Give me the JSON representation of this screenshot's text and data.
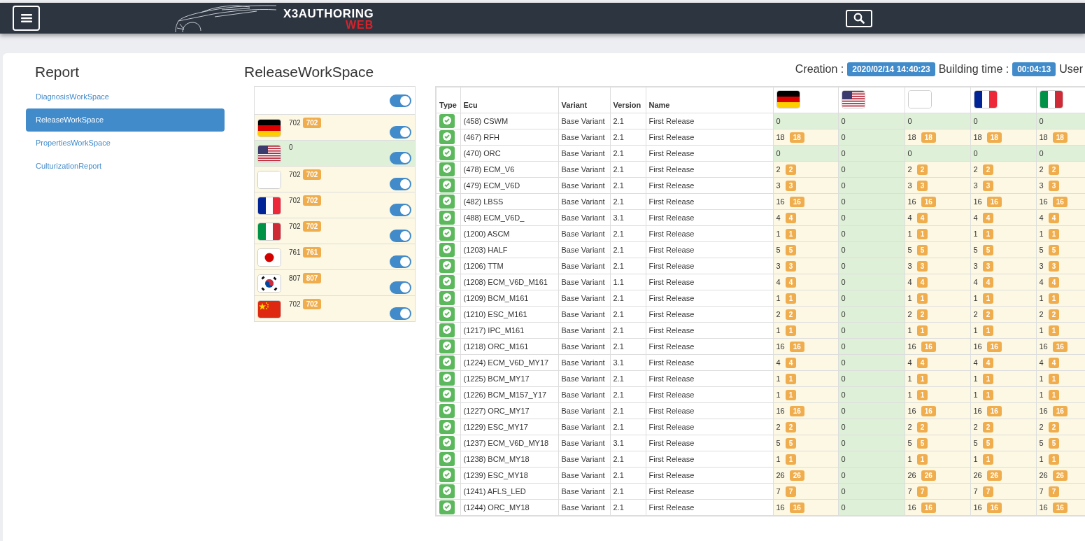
{
  "logo": {
    "title": "X3AUTHORING",
    "subtitle": "WEB"
  },
  "sidebar": {
    "title": "Report",
    "items": [
      {
        "label": "DiagnosisWorkSpace",
        "selected": false
      },
      {
        "label": "ReleaseWorkSpace",
        "selected": true
      },
      {
        "label": "PropertiesWorkSpace",
        "selected": false
      },
      {
        "label": "CulturizationReport",
        "selected": false
      }
    ]
  },
  "page_title": "ReleaseWorkSpace",
  "info": {
    "creation_label": "Creation :",
    "creation": "2020/02/14 14:40:23",
    "building_label": "Building time :",
    "building": "00:04:13",
    "user_label": "User"
  },
  "languages": {
    "all_on": true,
    "items": [
      {
        "kind": "de",
        "count": "702",
        "badge": "702",
        "on": true
      },
      {
        "kind": "us",
        "count": "0",
        "on": true
      },
      {
        "kind": "blank",
        "count": "702",
        "badge": "702",
        "on": true
      },
      {
        "kind": "fr",
        "count": "702",
        "badge": "702",
        "on": true
      },
      {
        "kind": "it",
        "count": "702",
        "badge": "702",
        "on": true
      },
      {
        "kind": "jp",
        "count": "761",
        "badge": "761",
        "on": true
      },
      {
        "kind": "kr",
        "count": "807",
        "badge": "807",
        "on": true
      },
      {
        "kind": "cn",
        "count": "702",
        "badge": "702",
        "on": true
      }
    ]
  },
  "table": {
    "columns": [
      "Type",
      "Ecu",
      "Variant",
      "Version",
      "Name"
    ],
    "flag_columns": [
      {
        "kind": "de"
      },
      {
        "kind": "us"
      },
      {
        "kind": "blank"
      },
      {
        "kind": "fr"
      },
      {
        "kind": "it"
      }
    ],
    "rows": [
      {
        "ecu": "(458) CSWM",
        "variant": "Base Variant",
        "version": "2.1",
        "name": "First Release",
        "cells": [
          {
            "value": "0"
          },
          {
            "value": "0"
          },
          {
            "value": "0"
          },
          {
            "value": "0"
          },
          {
            "value": "0"
          }
        ]
      },
      {
        "ecu": "(467) RFH",
        "variant": "Base Variant",
        "version": "2.1",
        "name": "First Release",
        "cells": [
          {
            "value": "18",
            "badge": "18"
          },
          {
            "value": "0"
          },
          {
            "value": "18",
            "badge": "18"
          },
          {
            "value": "18",
            "badge": "18"
          },
          {
            "value": "18",
            "badge": "18"
          }
        ]
      },
      {
        "ecu": "(470) ORC",
        "variant": "Base Variant",
        "version": "2.1",
        "name": "First Release",
        "cells": [
          {
            "value": "0"
          },
          {
            "value": "0"
          },
          {
            "value": "0"
          },
          {
            "value": "0"
          },
          {
            "value": "0"
          }
        ]
      },
      {
        "ecu": "(478) ECM_V6",
        "variant": "Base Variant",
        "version": "2.1",
        "name": "First Release",
        "cells": [
          {
            "value": "2",
            "badge": "2"
          },
          {
            "value": "0"
          },
          {
            "value": "2",
            "badge": "2"
          },
          {
            "value": "2",
            "badge": "2"
          },
          {
            "value": "2",
            "badge": "2"
          }
        ]
      },
      {
        "ecu": "(479) ECM_V6D",
        "variant": "Base Variant",
        "version": "2.1",
        "name": "First Release",
        "cells": [
          {
            "value": "3",
            "badge": "3"
          },
          {
            "value": "0"
          },
          {
            "value": "3",
            "badge": "3"
          },
          {
            "value": "3",
            "badge": "3"
          },
          {
            "value": "3",
            "badge": "3"
          }
        ]
      },
      {
        "ecu": "(482) LBSS",
        "variant": "Base Variant",
        "version": "2.1",
        "name": "First Release",
        "cells": [
          {
            "value": "16",
            "badge": "16"
          },
          {
            "value": "0"
          },
          {
            "value": "16",
            "badge": "16"
          },
          {
            "value": "16",
            "badge": "16"
          },
          {
            "value": "16",
            "badge": "16"
          }
        ]
      },
      {
        "ecu": "(488) ECM_V6D_",
        "variant": "Base Variant",
        "version": "3.1",
        "name": "First Release",
        "cells": [
          {
            "value": "4",
            "badge": "4"
          },
          {
            "value": "0"
          },
          {
            "value": "4",
            "badge": "4"
          },
          {
            "value": "4",
            "badge": "4"
          },
          {
            "value": "4",
            "badge": "4"
          }
        ]
      },
      {
        "ecu": "(1200) ASCM",
        "variant": "Base Variant",
        "version": "2.1",
        "name": "First Release",
        "cells": [
          {
            "value": "1",
            "badge": "1"
          },
          {
            "value": "0"
          },
          {
            "value": "1",
            "badge": "1"
          },
          {
            "value": "1",
            "badge": "1"
          },
          {
            "value": "1",
            "badge": "1"
          }
        ]
      },
      {
        "ecu": "(1203) HALF",
        "variant": "Base Variant",
        "version": "2.1",
        "name": "First Release",
        "cells": [
          {
            "value": "5",
            "badge": "5"
          },
          {
            "value": "0"
          },
          {
            "value": "5",
            "badge": "5"
          },
          {
            "value": "5",
            "badge": "5"
          },
          {
            "value": "5",
            "badge": "5"
          }
        ]
      },
      {
        "ecu": "(1206) TTM",
        "variant": "Base Variant",
        "version": "2.1",
        "name": "First Release",
        "cells": [
          {
            "value": "3",
            "badge": "3"
          },
          {
            "value": "0"
          },
          {
            "value": "3",
            "badge": "3"
          },
          {
            "value": "3",
            "badge": "3"
          },
          {
            "value": "3",
            "badge": "3"
          }
        ]
      },
      {
        "ecu": "(1208) ECM_V6D_M161",
        "variant": "Base Variant",
        "version": "1.1",
        "name": "First Release",
        "cells": [
          {
            "value": "4",
            "badge": "4"
          },
          {
            "value": "0"
          },
          {
            "value": "4",
            "badge": "4"
          },
          {
            "value": "4",
            "badge": "4"
          },
          {
            "value": "4",
            "badge": "4"
          }
        ]
      },
      {
        "ecu": "(1209) BCM_M161",
        "variant": "Base Variant",
        "version": "2.1",
        "name": "First Release",
        "cells": [
          {
            "value": "1",
            "badge": "1"
          },
          {
            "value": "0"
          },
          {
            "value": "1",
            "badge": "1"
          },
          {
            "value": "1",
            "badge": "1"
          },
          {
            "value": "1",
            "badge": "1"
          }
        ]
      },
      {
        "ecu": "(1210) ESC_M161",
        "variant": "Base Variant",
        "version": "2.1",
        "name": "First Release",
        "cells": [
          {
            "value": "2",
            "badge": "2"
          },
          {
            "value": "0"
          },
          {
            "value": "2",
            "badge": "2"
          },
          {
            "value": "2",
            "badge": "2"
          },
          {
            "value": "2",
            "badge": "2"
          }
        ]
      },
      {
        "ecu": "(1217) IPC_M161",
        "variant": "Base Variant",
        "version": "2.1",
        "name": "First Release",
        "cells": [
          {
            "value": "1",
            "badge": "1"
          },
          {
            "value": "0"
          },
          {
            "value": "1",
            "badge": "1"
          },
          {
            "value": "1",
            "badge": "1"
          },
          {
            "value": "1",
            "badge": "1"
          }
        ]
      },
      {
        "ecu": "(1218) ORC_M161",
        "variant": "Base Variant",
        "version": "2.1",
        "name": "First Release",
        "cells": [
          {
            "value": "16",
            "badge": "16"
          },
          {
            "value": "0"
          },
          {
            "value": "16",
            "badge": "16"
          },
          {
            "value": "16",
            "badge": "16"
          },
          {
            "value": "16",
            "badge": "16"
          }
        ]
      },
      {
        "ecu": "(1224) ECM_V6D_MY17",
        "variant": "Base Variant",
        "version": "3.1",
        "name": "First Release",
        "cells": [
          {
            "value": "4",
            "badge": "4"
          },
          {
            "value": "0"
          },
          {
            "value": "4",
            "badge": "4"
          },
          {
            "value": "4",
            "badge": "4"
          },
          {
            "value": "4",
            "badge": "4"
          }
        ]
      },
      {
        "ecu": "(1225) BCM_MY17",
        "variant": "Base Variant",
        "version": "2.1",
        "name": "First Release",
        "cells": [
          {
            "value": "1",
            "badge": "1"
          },
          {
            "value": "0"
          },
          {
            "value": "1",
            "badge": "1"
          },
          {
            "value": "1",
            "badge": "1"
          },
          {
            "value": "1",
            "badge": "1"
          }
        ]
      },
      {
        "ecu": "(1226) BCM_M157_Y17",
        "variant": "Base Variant",
        "version": "2.1",
        "name": "First Release",
        "cells": [
          {
            "value": "1",
            "badge": "1"
          },
          {
            "value": "0"
          },
          {
            "value": "1",
            "badge": "1"
          },
          {
            "value": "1",
            "badge": "1"
          },
          {
            "value": "1",
            "badge": "1"
          }
        ]
      },
      {
        "ecu": "(1227) ORC_MY17",
        "variant": "Base Variant",
        "version": "2.1",
        "name": "First Release",
        "cells": [
          {
            "value": "16",
            "badge": "16"
          },
          {
            "value": "0"
          },
          {
            "value": "16",
            "badge": "16"
          },
          {
            "value": "16",
            "badge": "16"
          },
          {
            "value": "16",
            "badge": "16"
          }
        ]
      },
      {
        "ecu": "(1229) ESC_MY17",
        "variant": "Base Variant",
        "version": "2.1",
        "name": "First Release",
        "cells": [
          {
            "value": "2",
            "badge": "2"
          },
          {
            "value": "0"
          },
          {
            "value": "2",
            "badge": "2"
          },
          {
            "value": "2",
            "badge": "2"
          },
          {
            "value": "2",
            "badge": "2"
          }
        ]
      },
      {
        "ecu": "(1237) ECM_V6D_MY18",
        "variant": "Base Variant",
        "version": "3.1",
        "name": "First Release",
        "cells": [
          {
            "value": "5",
            "badge": "5"
          },
          {
            "value": "0"
          },
          {
            "value": "5",
            "badge": "5"
          },
          {
            "value": "5",
            "badge": "5"
          },
          {
            "value": "5",
            "badge": "5"
          }
        ]
      },
      {
        "ecu": "(1238) BCM_MY18",
        "variant": "Base Variant",
        "version": "2.1",
        "name": "First Release",
        "cells": [
          {
            "value": "1",
            "badge": "1"
          },
          {
            "value": "0"
          },
          {
            "value": "1",
            "badge": "1"
          },
          {
            "value": "1",
            "badge": "1"
          },
          {
            "value": "1",
            "badge": "1"
          }
        ]
      },
      {
        "ecu": "(1239) ESC_MY18",
        "variant": "Base Variant",
        "version": "2.1",
        "name": "First Release",
        "cells": [
          {
            "value": "26",
            "badge": "26"
          },
          {
            "value": "0"
          },
          {
            "value": "26",
            "badge": "26"
          },
          {
            "value": "26",
            "badge": "26"
          },
          {
            "value": "26",
            "badge": "26"
          }
        ]
      },
      {
        "ecu": "(1241) AFLS_LED",
        "variant": "Base Variant",
        "version": "2.1",
        "name": "First Release",
        "cells": [
          {
            "value": "7",
            "badge": "7"
          },
          {
            "value": "0"
          },
          {
            "value": "7",
            "badge": "7"
          },
          {
            "value": "7",
            "badge": "7"
          },
          {
            "value": "7",
            "badge": "7"
          }
        ]
      },
      {
        "ecu": "(1244) ORC_MY18",
        "variant": "Base Variant",
        "version": "2.1",
        "name": "First Release",
        "cells": [
          {
            "value": "16",
            "badge": "16"
          },
          {
            "value": "0"
          },
          {
            "value": "16",
            "badge": "16"
          },
          {
            "value": "16",
            "badge": "16"
          },
          {
            "value": "16",
            "badge": "16"
          }
        ]
      }
    ]
  }
}
